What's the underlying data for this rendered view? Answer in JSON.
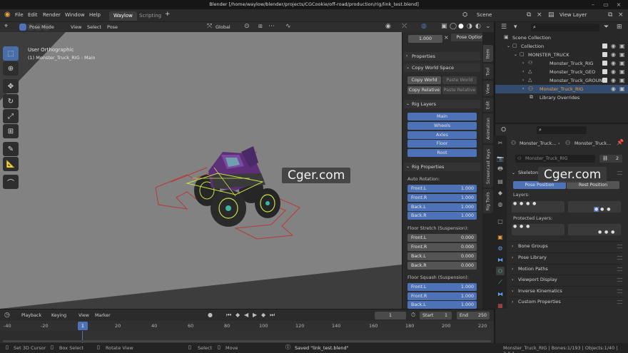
{
  "window": {
    "title": "Blender [/home/waylow/blender/projects/CGCookie/off-road/production/rig/link_test.blend]"
  },
  "topbar": {
    "menus": [
      "File",
      "Edit",
      "Render",
      "Window",
      "Help"
    ],
    "workspace_tabs": [
      "Waylow",
      "Scripting"
    ],
    "add_tab": "+",
    "scene_label": "Scene",
    "view_layer_label": "View Layer"
  },
  "viewport_header": {
    "mode": "Pose Mode",
    "menus": [
      "View",
      "Select",
      "Pose"
    ],
    "orientation": "Global",
    "frame_value": "1.000"
  },
  "viewport": {
    "view_name": "User Orthographic",
    "object_info": "(1) Monster_Truck_RIG : Main"
  },
  "npanel": {
    "pose_options": "Pose Options",
    "properties": "Properties",
    "copy_world_space": {
      "title": "Copy World Space",
      "copy_world": "Copy World",
      "paste_world": "Paste World",
      "copy_relative": "Copy Relative",
      "paste_relative": "Paste Relative"
    },
    "rig_layers": {
      "title": "Rig Layers",
      "layers": [
        "Main",
        "Wheels",
        "Axles",
        "Floor",
        "Root"
      ]
    },
    "rig_properties": {
      "title": "Rig Properties",
      "auto_rotation": {
        "label": "Auto Rotation:",
        "items": [
          {
            "name": "Front.L",
            "value": "1.000"
          },
          {
            "name": "Front.R",
            "value": "1.000"
          },
          {
            "name": "Back.L",
            "value": "1.000"
          },
          {
            "name": "Back.R",
            "value": "1.000"
          }
        ]
      },
      "floor_stretch": {
        "label": "Floor Stretch (Suspension):",
        "items": [
          {
            "name": "Front.L",
            "value": "0.000"
          },
          {
            "name": "Front.R",
            "value": "0.000"
          },
          {
            "name": "Back.L",
            "value": "0.000"
          },
          {
            "name": "Back.R",
            "value": "0.000"
          }
        ]
      },
      "floor_squash": {
        "label": "Floor Squash (Suspension):",
        "items": [
          {
            "name": "Front.L",
            "value": "1.000"
          },
          {
            "name": "Front.R",
            "value": "1.000"
          },
          {
            "name": "Back.L",
            "value": "1.000"
          }
        ]
      }
    }
  },
  "vertical_tabs": [
    "Item",
    "Tool",
    "View",
    "Edit",
    "Animation",
    "Screencast Keys",
    "Rig Tools"
  ],
  "outliner": {
    "rows": [
      {
        "label": "Scene Collection",
        "indent": 0
      },
      {
        "label": "Collection",
        "indent": 1
      },
      {
        "label": "MONSTER_TRUCK",
        "indent": 2
      },
      {
        "label": "Monster_Truck_RIG",
        "indent": 3
      },
      {
        "label": "Monster_Truck_GEO",
        "indent": 3
      },
      {
        "label": "Monster_Truck_GROUN",
        "indent": 3
      },
      {
        "label": "Monster_Truck_RIG",
        "indent": 2,
        "highlight": true
      },
      {
        "label": "Library Overrides",
        "indent": 2
      }
    ]
  },
  "properties": {
    "breadcrumb_object": "Monster_Truck...",
    "breadcrumb_data": "Monster_Truck...",
    "data_name": "Monster_Truck_RIG",
    "user_count": "2",
    "skeleton": {
      "title": "Skeleton",
      "pose_position": "Pose Position",
      "rest_position": "Rest Position",
      "layers_label": "Layers:",
      "protected_label": "Protected Layers:"
    },
    "sections": [
      "Bone Groups",
      "Pose Library",
      "Motion Paths",
      "Viewport Display",
      "Inverse Kinematics",
      "Custom Properties"
    ]
  },
  "timeline": {
    "menus": [
      "Playback",
      "Keying",
      "View",
      "Marker"
    ],
    "current_frame": "1",
    "start_label": "Start",
    "start": "1",
    "end_label": "End",
    "end": "250",
    "ruler": [
      "-40",
      "-20",
      "1",
      "20",
      "40",
      "60",
      "80",
      "100",
      "120",
      "140",
      "160",
      "180",
      "200",
      "220"
    ]
  },
  "statusbar": {
    "set_cursor": "Set 3D Cursor",
    "box_select": "Box Select",
    "rotate_view": "Rotate View",
    "select": "Select",
    "move": "Move",
    "saved": "Saved \"link_test.blend\"",
    "stats": "Monster_Truck_RIG | Bones:1/193 | Objects:1/40 | 3.0.1"
  },
  "watermark": "Cger.com",
  "colors": {
    "accent_blue": "#4d72b8",
    "viewport_bg": "#3d3d3d",
    "highlight_orange": "#e8a040"
  }
}
